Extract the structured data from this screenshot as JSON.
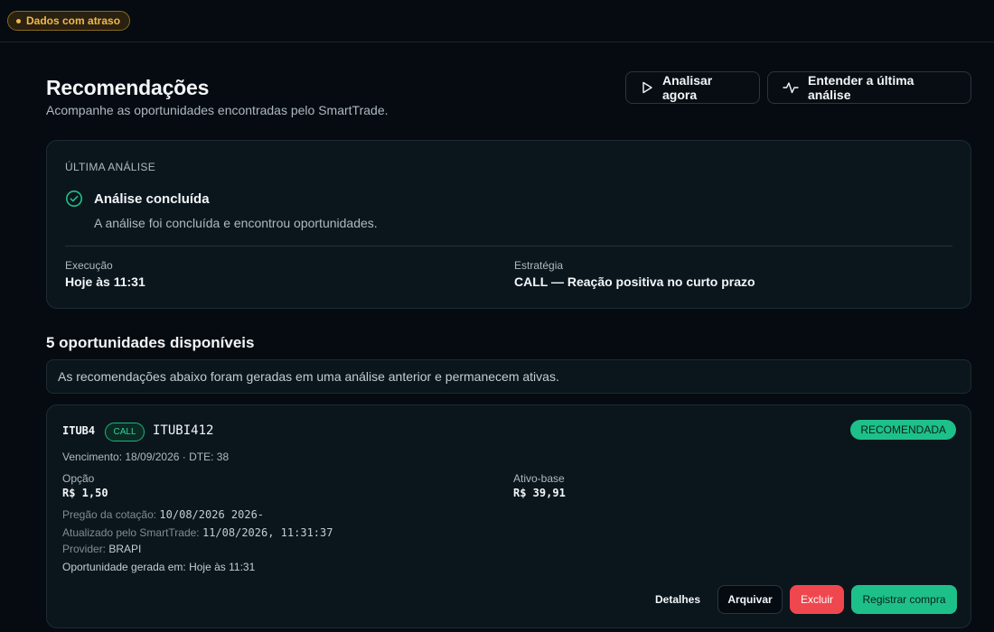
{
  "status_badge": {
    "label": "Dados com atraso",
    "color": "#f1b94b"
  },
  "header": {
    "title": "Recomendações",
    "subtitle": "Acompanhe as oportunidades encontradas pelo SmartTrade.",
    "buttons": {
      "analyze": {
        "label": "Analisar agora",
        "icon": "play-icon"
      },
      "understand": {
        "label": "Entender a última análise",
        "icon": "activity-icon"
      }
    }
  },
  "last_analysis": {
    "kicker": "ÚLTIMA ANÁLISE",
    "status": "Análise concluída",
    "status_icon": "check-circle-icon",
    "description": "A análise foi concluída e encontrou oportunidades.",
    "execution_label": "Execução",
    "execution_value": "Hoje às 11:31",
    "strategy_label": "Estratégia",
    "strategy_value": "CALL — Reação positiva no curto prazo"
  },
  "opportunities": {
    "title": "5 oportunidades disponíveis",
    "notice": "As recomendações abaixo foram geradas em uma análise anterior e permanecem ativas.",
    "items": [
      {
        "ticker": "ITUB4",
        "type": "CALL",
        "option_code": "ITUBI412",
        "badge": "RECOMENDADA",
        "expiry": "Vencimento: 18/09/2026 · DTE: 38",
        "option_label": "Opção",
        "option_price": "R$ 1,50",
        "underlying_label": "Ativo-base",
        "underlying_price": "R$ 39,91",
        "quote_session_label": "Pregão da cotação: ",
        "quote_session_value": "10/08/2026 2026-",
        "updated_label": "Atualizado pelo SmartTrade: ",
        "updated_value": "11/08/2026, 11:31:37",
        "provider_label": "Provider: ",
        "provider_value": "BRAPI",
        "generated": "Oportunidade gerada em: Hoje às 11:31",
        "actions": {
          "details": "Detalhes",
          "archive": "Arquivar",
          "delete": "Excluir",
          "register": "Registrar compra"
        }
      }
    ]
  },
  "colors": {
    "background": "#050b10",
    "card": "#0b161c",
    "accent_green": "#1ec08a",
    "danger_red": "#f0474f",
    "warning_amber": "#f1b94b"
  }
}
